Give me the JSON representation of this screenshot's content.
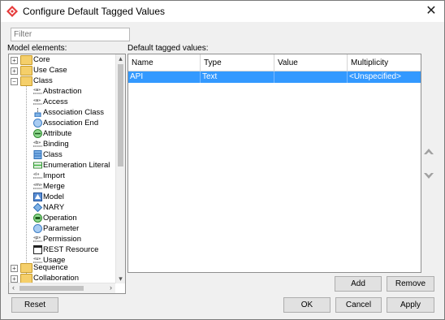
{
  "window": {
    "title": "Configure Default Tagged Values",
    "close_glyph": "✕"
  },
  "filter": {
    "placeholder": "Filter"
  },
  "labels": {
    "model_elements": "Model elements:",
    "default_tagged_values": "Default tagged values:"
  },
  "tree": {
    "items": [
      {
        "label": "Core",
        "kind": "folder",
        "expander": "+"
      },
      {
        "label": "Use Case",
        "kind": "folder",
        "expander": "+"
      },
      {
        "label": "Class",
        "kind": "folder",
        "expander": "−"
      },
      {
        "label": "Abstraction",
        "kind": "stereotype-icon"
      },
      {
        "label": "Access",
        "kind": "stereotype-icon"
      },
      {
        "label": "Association Class",
        "kind": "association-class-icon"
      },
      {
        "label": "Association End",
        "kind": "association-end-icon"
      },
      {
        "label": "Attribute",
        "kind": "attribute-icon"
      },
      {
        "label": "Binding",
        "kind": "stereotype-icon"
      },
      {
        "label": "Class",
        "kind": "class-icon"
      },
      {
        "label": "Enumeration Literal",
        "kind": "enumeration-literal-icon"
      },
      {
        "label": "Import",
        "kind": "stereotype-icon"
      },
      {
        "label": "Merge",
        "kind": "stereotype-icon"
      },
      {
        "label": "Model",
        "kind": "model-icon"
      },
      {
        "label": "NARY",
        "kind": "nary-icon"
      },
      {
        "label": "Operation",
        "kind": "operation-icon"
      },
      {
        "label": "Parameter",
        "kind": "parameter-icon"
      },
      {
        "label": "Permission",
        "kind": "stereotype-icon"
      },
      {
        "label": "REST Resource",
        "kind": "rest-resource-icon"
      },
      {
        "label": "Usage",
        "kind": "stereotype-icon"
      },
      {
        "label": "Sequence",
        "kind": "folder",
        "expander": "+"
      },
      {
        "label": "Collaboration",
        "kind": "folder",
        "expander": "+"
      }
    ]
  },
  "table": {
    "columns": [
      "Name",
      "Type",
      "Value",
      "Multiplicity"
    ],
    "rows": [
      {
        "name": "API",
        "type": "Text",
        "value": "",
        "multiplicity": "<Unspecified>"
      }
    ]
  },
  "buttons": {
    "add": "Add",
    "remove": "Remove",
    "reset": "Reset",
    "ok": "OK",
    "cancel": "Cancel",
    "apply": "Apply"
  },
  "colors": {
    "selection": "#3399ff",
    "folder": "#f5cf6a",
    "app_icon": "#e63b3b"
  }
}
